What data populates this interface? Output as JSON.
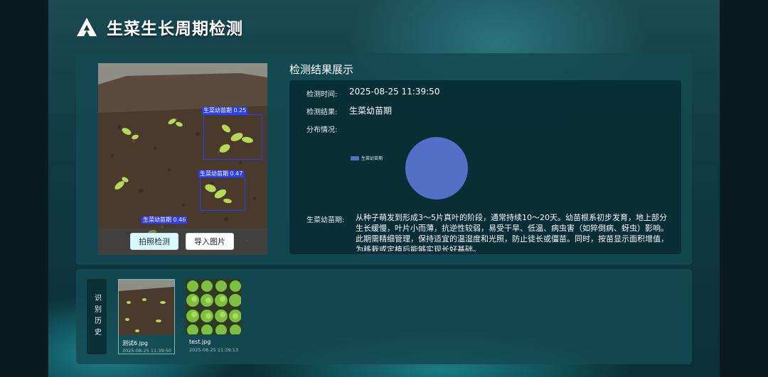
{
  "header": {
    "title": "生菜生长周期检测"
  },
  "image_panel": {
    "detections": [
      {
        "label": "生菜幼苗期 0.25"
      },
      {
        "label": "生菜幼苗期 0.47"
      },
      {
        "label": "生菜幼苗期 0.46"
      }
    ],
    "buttons": {
      "capture": "拍照检测",
      "import": "导入图片"
    }
  },
  "results": {
    "title": "检测结果展示",
    "time_label": "检测时间:",
    "time_value": "2025-08-25 11:39:50",
    "result_label": "检测结果:",
    "result_value": "生菜幼苗期",
    "distribution_label": "分布情况:",
    "description_label": "生菜幼苗期:",
    "description": "从种子萌发到形成3～5片真叶的阶段，通常持续10～20天。幼苗根系初步发育，地上部分生长缓慢，叶片小而薄，抗逆性较弱，易受干旱、低温、病虫害（如猝倒病、蚜虫）影响。此期需精细管理，保持适宜的温湿度和光照，防止徒长或僵苗。同时，按苗显示面积增值，为移栽或定植后能够实现长好基础。"
  },
  "chart_data": {
    "type": "pie",
    "title": "",
    "legend_position": "left",
    "slices": [
      {
        "name": "生菜幼苗期",
        "value": 1,
        "color": "#5470c6"
      }
    ]
  },
  "history": {
    "tab_label": "识别历史",
    "items": [
      {
        "filename": "测试6.jpg",
        "time": "2025-08-25 11:39:50"
      },
      {
        "filename": "test.jpg",
        "time": "2025-08-25 11:39:13"
      }
    ]
  },
  "colors": {
    "accent": "#5470c6",
    "detection_box": "#2a3cff",
    "panel": "#144a52"
  }
}
